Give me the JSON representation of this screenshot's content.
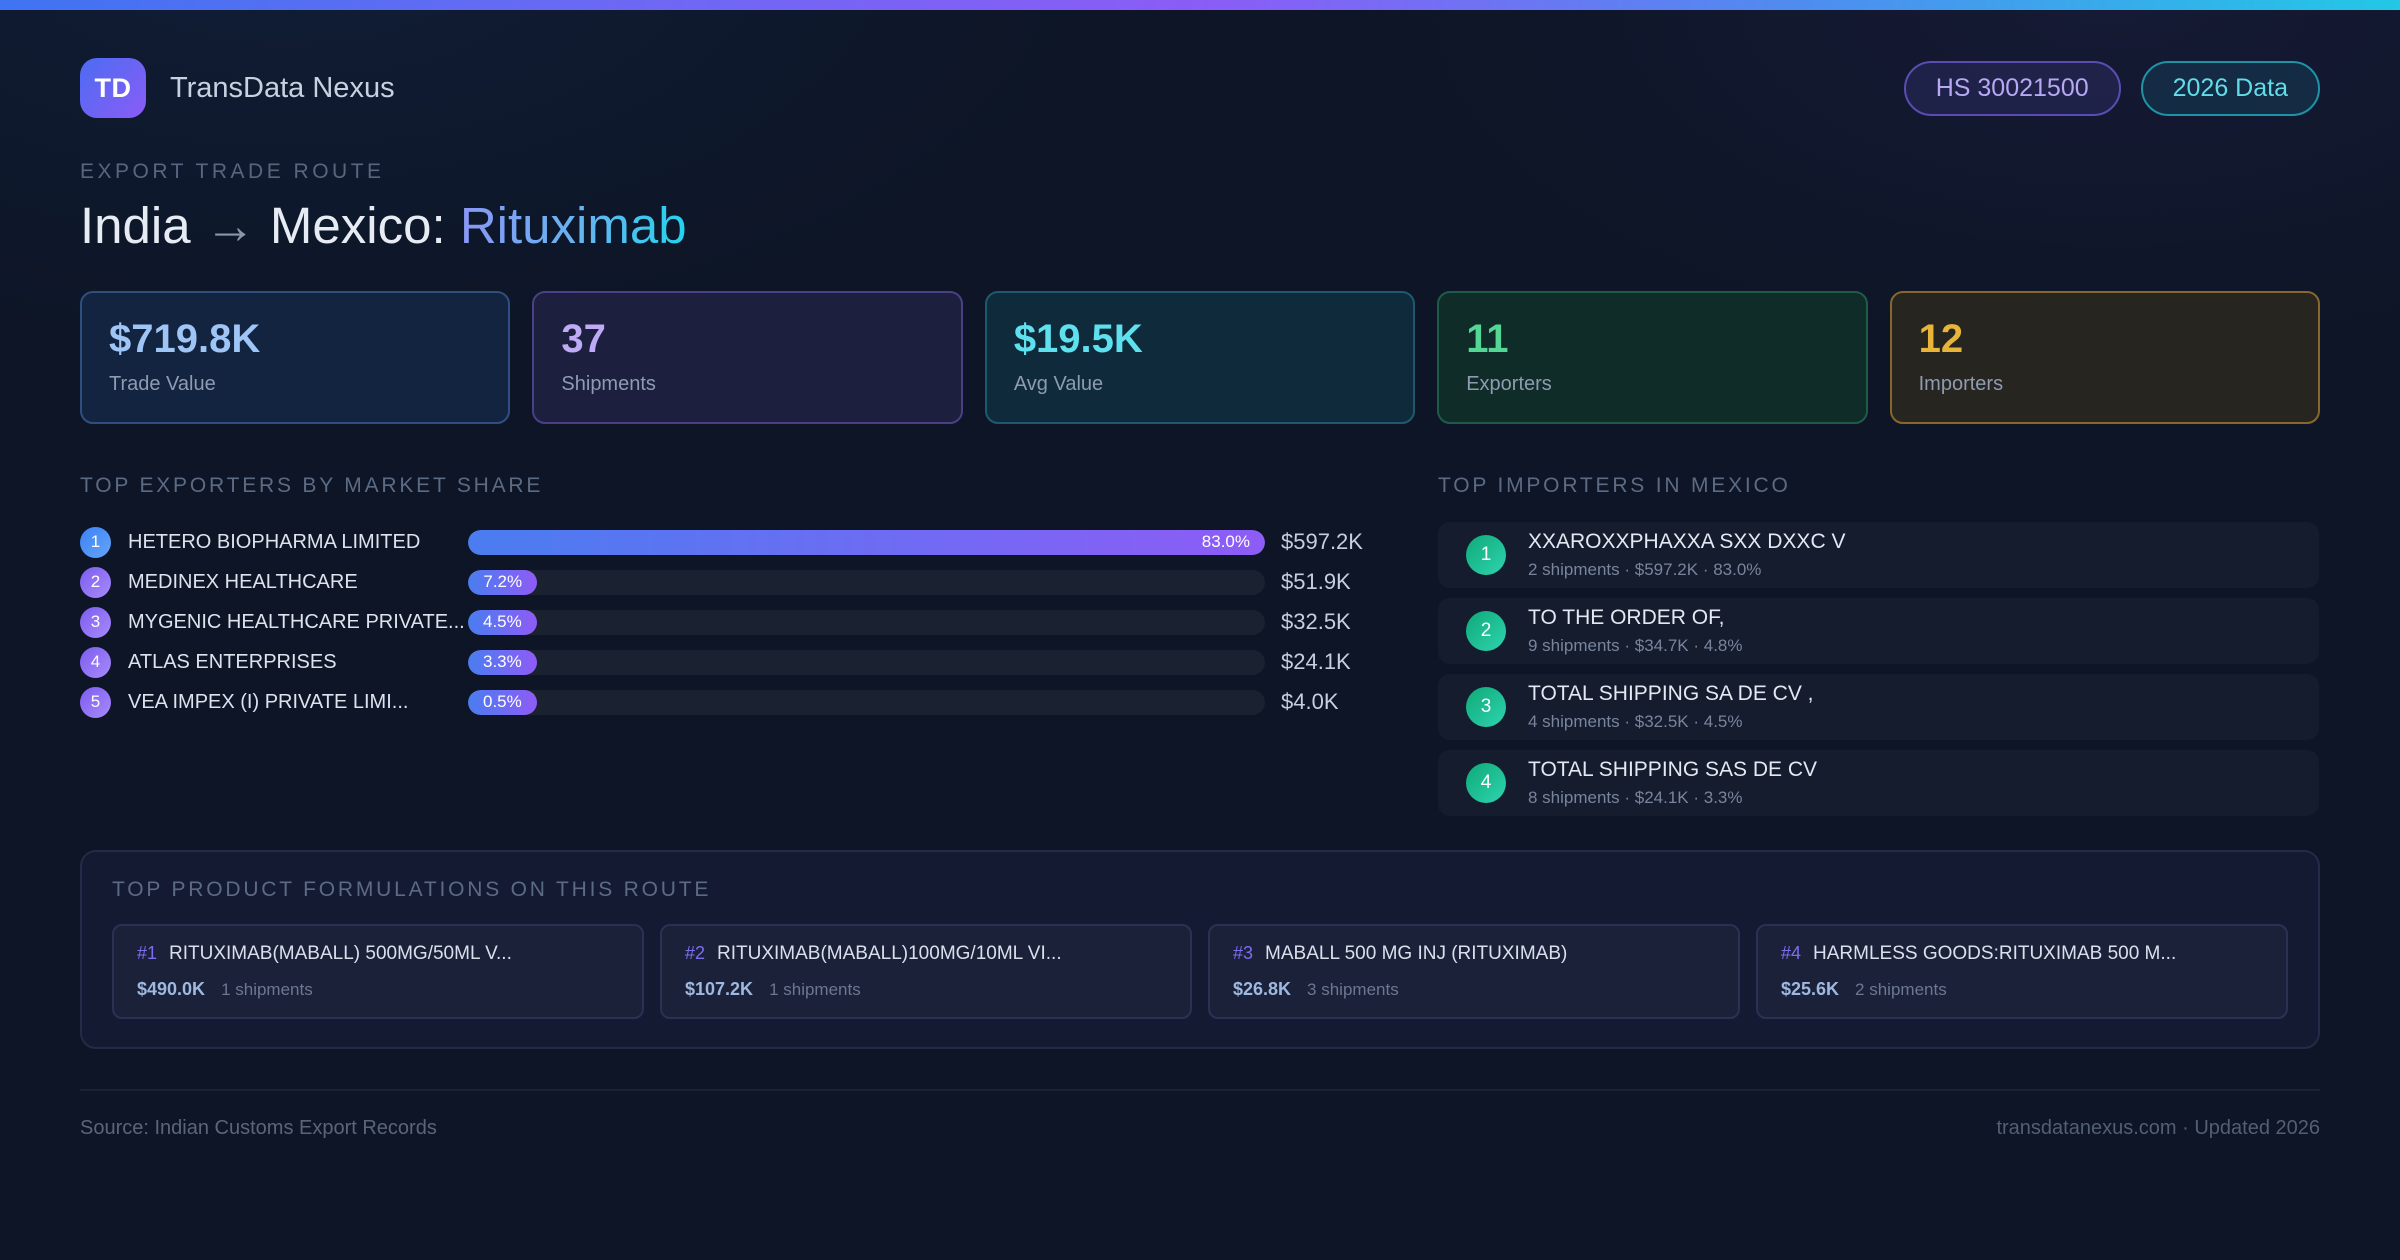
{
  "header": {
    "logo_text": "TD",
    "brand": "TransData Nexus",
    "badges": [
      {
        "label": "HS 30021500"
      },
      {
        "label": "2026 Data"
      }
    ]
  },
  "hero": {
    "eyebrow": "EXPORT TRADE ROUTE",
    "origin": "India",
    "arrow": "→",
    "destination": " Mexico: ",
    "product": "Rituximab"
  },
  "stats": [
    {
      "value": "$719.8K",
      "label": "Trade Value"
    },
    {
      "value": "37",
      "label": "Shipments"
    },
    {
      "value": "$19.5K",
      "label": "Avg Value"
    },
    {
      "value": "11",
      "label": "Exporters"
    },
    {
      "value": "12",
      "label": "Importers"
    }
  ],
  "exporters": {
    "title": "TOP EXPORTERS BY MARKET SHARE",
    "max_share": 83.0,
    "items": [
      {
        "rank": "1",
        "name": "HETERO BIOPHARMA LIMITED",
        "share_pct": 83.0,
        "share_label": "83.0%",
        "value": "$597.2K"
      },
      {
        "rank": "2",
        "name": "MEDINEX HEALTHCARE",
        "share_pct": 7.2,
        "share_label": "7.2%",
        "value": "$51.9K"
      },
      {
        "rank": "3",
        "name": "MYGENIC HEALTHCARE PRIVATE...",
        "share_pct": 4.5,
        "share_label": "4.5%",
        "value": "$32.5K"
      },
      {
        "rank": "4",
        "name": "ATLAS ENTERPRISES",
        "share_pct": 3.3,
        "share_label": "3.3%",
        "value": "$24.1K"
      },
      {
        "rank": "5",
        "name": "VEA IMPEX (I) PRIVATE LIMI...",
        "share_pct": 0.5,
        "share_label": "0.5%",
        "value": "$4.0K"
      }
    ]
  },
  "importers": {
    "title": "TOP IMPORTERS IN MEXICO",
    "items": [
      {
        "rank": "1",
        "name": "XXAROXXPHAXXA SXX DXXC V",
        "meta": "2 shipments · $597.2K · 83.0%"
      },
      {
        "rank": "2",
        "name": "TO THE ORDER OF,",
        "meta": "9 shipments · $34.7K · 4.8%"
      },
      {
        "rank": "3",
        "name": "TOTAL SHIPPING SA DE CV ,",
        "meta": "4 shipments · $32.5K · 4.5%"
      },
      {
        "rank": "4",
        "name": "TOTAL SHIPPING SAS DE CV",
        "meta": "8 shipments · $24.1K · 3.3%"
      }
    ]
  },
  "formulations": {
    "title": "TOP PRODUCT FORMULATIONS ON THIS ROUTE",
    "items": [
      {
        "rank": "#1",
        "name": "RITUXIMAB(MABALL) 500MG/50ML V...",
        "value": "$490.0K",
        "shipments": "1 shipments"
      },
      {
        "rank": "#2",
        "name": "RITUXIMAB(MABALL)100MG/10ML VI...",
        "value": "$107.2K",
        "shipments": "1 shipments"
      },
      {
        "rank": "#3",
        "name": "MABALL 500 MG INJ (RITUXIMAB)",
        "value": "$26.8K",
        "shipments": "3 shipments"
      },
      {
        "rank": "#4",
        "name": "HARMLESS GOODS:RITUXIMAB 500 M...",
        "value": "$25.6K",
        "shipments": "2 shipments"
      }
    ]
  },
  "footer": {
    "source": "Source: Indian Customs Export Records",
    "site": "transdatanexus.com · Updated 2026"
  },
  "colors": {
    "accent_blue": "#4a7df0",
    "accent_purple": "#8b5cf6",
    "accent_cyan": "#22d3ee",
    "accent_green": "#54d694",
    "accent_amber": "#e9b43a"
  }
}
